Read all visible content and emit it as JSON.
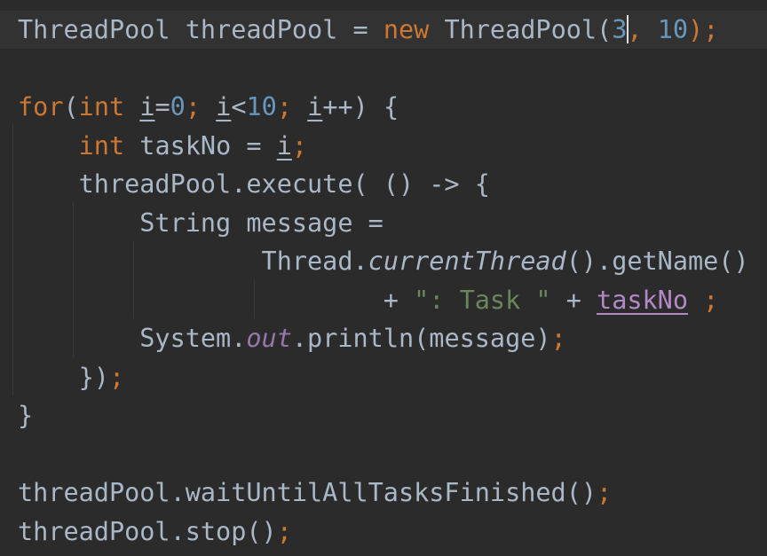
{
  "editor": {
    "lines": [
      [
        {
          "t": "ThreadPool threadPool = ",
          "c": ""
        },
        {
          "t": "new",
          "c": "kw"
        },
        {
          "t": " ThreadPool(",
          "c": ""
        },
        {
          "t": "3",
          "c": "num"
        },
        {
          "t": "",
          "c": "caret"
        },
        {
          "t": ",",
          "c": "kw"
        },
        {
          "t": " ",
          "c": ""
        },
        {
          "t": "10",
          "c": "num"
        },
        {
          "t": ");",
          "c": "kw"
        }
      ],
      [],
      [
        {
          "t": "for",
          "c": "kw"
        },
        {
          "t": "(",
          "c": ""
        },
        {
          "t": "int",
          "c": "kw"
        },
        {
          "t": " ",
          "c": ""
        },
        {
          "t": "i",
          "c": "und"
        },
        {
          "t": "=",
          "c": ""
        },
        {
          "t": "0",
          "c": "num"
        },
        {
          "t": ";",
          "c": "kw"
        },
        {
          "t": " ",
          "c": ""
        },
        {
          "t": "i",
          "c": "und"
        },
        {
          "t": "<",
          "c": ""
        },
        {
          "t": "10",
          "c": "num"
        },
        {
          "t": ";",
          "c": "kw"
        },
        {
          "t": " ",
          "c": ""
        },
        {
          "t": "i",
          "c": "und"
        },
        {
          "t": "++) {",
          "c": ""
        }
      ],
      [
        {
          "t": "    ",
          "c": ""
        },
        {
          "t": "int",
          "c": "kw"
        },
        {
          "t": " taskNo = ",
          "c": ""
        },
        {
          "t": "i",
          "c": "und"
        },
        {
          "t": ";",
          "c": "kw"
        }
      ],
      [
        {
          "t": "    threadPool.execute( () -> {",
          "c": ""
        }
      ],
      [
        {
          "t": "        String message =",
          "c": ""
        }
      ],
      [
        {
          "t": "                Thread.",
          "c": ""
        },
        {
          "t": "currentThread",
          "c": "fi"
        },
        {
          "t": "().getName()",
          "c": ""
        }
      ],
      [
        {
          "t": "                        + ",
          "c": ""
        },
        {
          "t": "\": Task \"",
          "c": "str"
        },
        {
          "t": " + ",
          "c": ""
        },
        {
          "t": "taskNo",
          "c": "cap"
        },
        {
          "t": " ",
          "c": ""
        },
        {
          "t": ";",
          "c": "kw"
        }
      ],
      [
        {
          "t": "        System.",
          "c": ""
        },
        {
          "t": "out",
          "c": "st"
        },
        {
          "t": ".println(message)",
          "c": ""
        },
        {
          "t": ";",
          "c": "kw"
        }
      ],
      [
        {
          "t": "    })",
          "c": ""
        },
        {
          "t": ";",
          "c": "kw"
        }
      ],
      [
        {
          "t": "}",
          "c": ""
        }
      ],
      [],
      [
        {
          "t": "threadPool.waitUntilAllTasksFinished()",
          "c": ""
        },
        {
          "t": ";",
          "c": "kw"
        }
      ],
      [
        {
          "t": "threadPool.stop()",
          "c": ""
        },
        {
          "t": ";",
          "c": "kw"
        }
      ]
    ],
    "colors": {
      "background": "#2b2b2b",
      "current_line": "#323232",
      "default_text": "#a9b7c6",
      "keyword": "#cc7832",
      "number": "#6897bb",
      "string": "#6a8759",
      "static_field": "#9876aa",
      "captured_variable": "#b389c5"
    }
  }
}
